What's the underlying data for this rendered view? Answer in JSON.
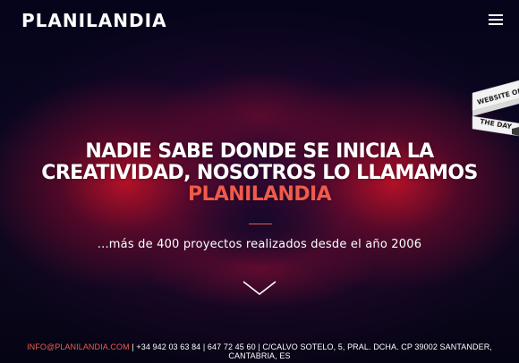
{
  "header": {
    "logo": "PLANILANDIA",
    "menu_icon": "hamburger-menu-icon"
  },
  "badge": {
    "line1": "WEBSITE OF",
    "line2": "THE DAY",
    "icon": "award-ribbon-icon"
  },
  "hero": {
    "headline_line1": "NADIE SABE DONDE SE INICIA LA",
    "headline_line2": "CREATIVIDAD, NOSOTROS LO LLAMAMOS",
    "headline_accent": "PLANILANDIA",
    "subtitle": "...más de 400 proyectos realizados desde el año 2006",
    "scroll_icon": "chevron-down-icon"
  },
  "footer": {
    "email": "INFO@PLANILANDIA.COM",
    "details": " | +34 942 03 63 84 | 647 72 45 60 | C/CALVO SOTELO, 5, PRAL. DCHA. CP 39002 SANTANDER, CANTABRIA, ES"
  },
  "colors": {
    "accent": "#f05a4a",
    "background": "#07061a",
    "text": "#ffffff"
  }
}
